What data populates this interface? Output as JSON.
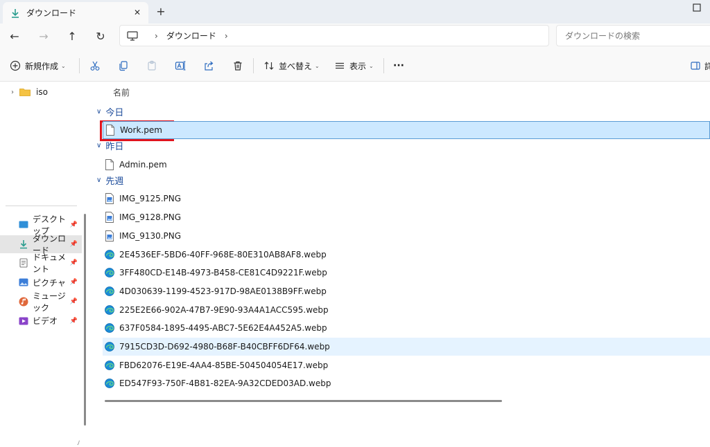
{
  "window": {
    "tab_title": "ダウンロード",
    "tab_close": "✕",
    "new_tab": "+"
  },
  "nav": {
    "back": "←",
    "forward": "→",
    "up": "↑",
    "refresh": "↻",
    "breadcrumb": [
      "ダウンロード"
    ],
    "breadcrumb_sep": "›",
    "search_placeholder": "ダウンロードの検索"
  },
  "toolbar": {
    "new_label": "新規作成",
    "sort_label": "並べ替え",
    "view_label": "表示",
    "more": "···",
    "details_label": "詳"
  },
  "sidebar": {
    "tree": [
      {
        "label": "iso",
        "chevron": "›"
      }
    ],
    "quick_access": [
      {
        "label": "デスクトップ",
        "icon": "desktop-icon",
        "color": "#2f8fd8"
      },
      {
        "label": "ダウンロード",
        "icon": "download-icon",
        "color": "#2a9d8f",
        "selected": true
      },
      {
        "label": "ドキュメント",
        "icon": "documents-icon",
        "color": "#7a7a7a"
      },
      {
        "label": "ピクチャ",
        "icon": "pictures-icon",
        "color": "#3b7dd8"
      },
      {
        "label": "ミュージック",
        "icon": "music-icon",
        "color": "#e0683b"
      },
      {
        "label": "ビデオ",
        "icon": "videos-icon",
        "color": "#8a44c9"
      }
    ],
    "pin": "📌",
    "mark": "ﾉ"
  },
  "content": {
    "column_name": "名前",
    "groups": [
      {
        "label": "今日",
        "chevron": "∨",
        "files": [
          {
            "name": "Work.pem",
            "type": "file",
            "selected": true
          }
        ]
      },
      {
        "label": "昨日",
        "chevron": "∨",
        "files": [
          {
            "name": "Admin.pem",
            "type": "file"
          }
        ]
      },
      {
        "label": "先週",
        "chevron": "∨",
        "files": [
          {
            "name": "IMG_9125.PNG",
            "type": "image"
          },
          {
            "name": "IMG_9128.PNG",
            "type": "image"
          },
          {
            "name": "IMG_9130.PNG",
            "type": "image"
          },
          {
            "name": "2E4536EF-5BD6-40FF-968E-80E310AB8AF8.webp",
            "type": "webp"
          },
          {
            "name": "3FF480CD-E14B-4973-B458-CE81C4D9221F.webp",
            "type": "webp"
          },
          {
            "name": "4D030639-1199-4523-917D-98AE0138B9FF.webp",
            "type": "webp"
          },
          {
            "name": "225E2E66-902A-47B7-9E90-93A4A1ACC595.webp",
            "type": "webp"
          },
          {
            "name": "637F0584-1895-4495-ABC7-5E62E4A452A5.webp",
            "type": "webp"
          },
          {
            "name": "7915CD3D-D692-4980-B68F-B40CBFF6DF64.webp",
            "type": "webp",
            "hover": true
          },
          {
            "name": "FBD62076-E19E-4AA4-85BE-504504054E17.webp",
            "type": "webp"
          },
          {
            "name": "ED547F93-750F-4B81-82EA-9A32CDED03AD.webp",
            "type": "webp"
          }
        ]
      }
    ]
  },
  "colors": {
    "accent": "#1f4e9c",
    "selection_fill": "#cce8ff",
    "selection_border": "#5a9bd4",
    "highlight_box": "#e0141e",
    "download_green": "#2a9d8f"
  }
}
